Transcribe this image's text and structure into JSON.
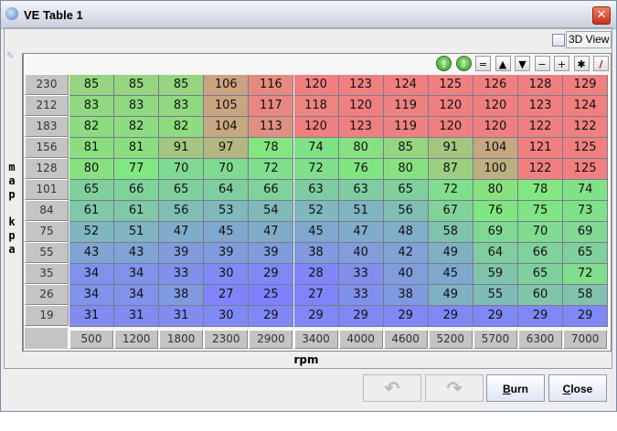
{
  "window": {
    "title": "VE Table 1"
  },
  "view3d": {
    "label": "3D View",
    "checked": false
  },
  "toolbar": {
    "buttons": [
      {
        "name": "shift-up",
        "glyph": "⇧"
      },
      {
        "name": "shift-down",
        "glyph": "⇩"
      },
      {
        "name": "set-equal",
        "glyph": "="
      },
      {
        "name": "increment",
        "glyph": "▲"
      },
      {
        "name": "decrement",
        "glyph": "▼"
      },
      {
        "name": "subtract",
        "glyph": "−"
      },
      {
        "name": "add",
        "glyph": "+"
      },
      {
        "name": "multiply",
        "glyph": "✱"
      },
      {
        "name": "interpolate",
        "glyph": "/"
      }
    ]
  },
  "table": {
    "y_axis_label": "map kpa",
    "x_axis_label": "rpm",
    "rows_kpa": [
      "230",
      "212",
      "183",
      "156",
      "128",
      "101",
      "84",
      "75",
      "55",
      "35",
      "26",
      "19"
    ],
    "cols_rpm": [
      "500",
      "1200",
      "1800",
      "2300",
      "2900",
      "3400",
      "4000",
      "4600",
      "5200",
      "5700",
      "6300",
      "7000"
    ],
    "values": [
      [
        85,
        85,
        85,
        106,
        116,
        120,
        123,
        124,
        125,
        126,
        128,
        129
      ],
      [
        83,
        83,
        83,
        105,
        117,
        118,
        120,
        119,
        120,
        120,
        123,
        124
      ],
      [
        82,
        82,
        82,
        104,
        113,
        120,
        123,
        119,
        120,
        120,
        122,
        122
      ],
      [
        81,
        81,
        91,
        97,
        78,
        74,
        80,
        85,
        91,
        104,
        121,
        125
      ],
      [
        80,
        77,
        70,
        70,
        72,
        72,
        76,
        80,
        87,
        100,
        122,
        125
      ],
      [
        65,
        66,
        65,
        64,
        66,
        63,
        63,
        65,
        72,
        80,
        78,
        74
      ],
      [
        61,
        61,
        56,
        53,
        54,
        52,
        51,
        56,
        67,
        76,
        75,
        73
      ],
      [
        52,
        51,
        47,
        45,
        47,
        45,
        47,
        48,
        58,
        69,
        70,
        69
      ],
      [
        43,
        43,
        39,
        39,
        39,
        38,
        40,
        42,
        49,
        64,
        66,
        65
      ],
      [
        34,
        34,
        33,
        30,
        29,
        28,
        33,
        40,
        45,
        59,
        65,
        72
      ],
      [
        34,
        34,
        38,
        27,
        25,
        27,
        33,
        38,
        49,
        55,
        60,
        58
      ],
      [
        31,
        31,
        31,
        30,
        29,
        29,
        29,
        29,
        29,
        29,
        29,
        29
      ]
    ]
  },
  "buttons": {
    "undo": "↶",
    "redo": "↷",
    "burn_pre": "",
    "burn_ul": "B",
    "burn_post": "urn",
    "close_ul": "C",
    "close_post": "lose"
  },
  "colors": {
    "low": "#8080ff",
    "mid": "#80e880",
    "high": "#f08080"
  }
}
